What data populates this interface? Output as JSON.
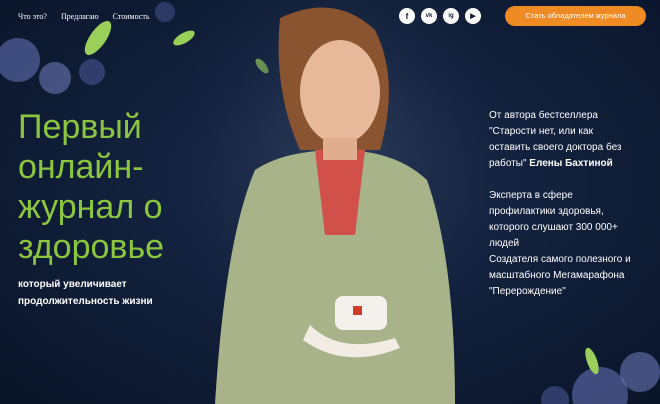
{
  "nav": {
    "items": [
      "Что это?",
      "Предлагаю",
      "Стоимость"
    ]
  },
  "social": {
    "items": [
      "f",
      "vk",
      "ig",
      "▶"
    ]
  },
  "cta": {
    "label": "Стать обладателем журнала"
  },
  "hero": {
    "headline": [
      "Первый",
      "онлайн-",
      "журнал о",
      "здоровье"
    ],
    "subheadline": [
      "который увеличивает",
      "продолжительность жизни"
    ],
    "author_lines": [
      "От автора бестселлера",
      "\"Старости нет, или как",
      "оставить своего доктора без",
      "работы\""
    ],
    "author_name": "Елены Бахтиной",
    "expert_lines": [
      "Эксперта в сфере",
      "профилактики здоровья,",
      "которого слушают 300 000+",
      "людей",
      "Создателя самого полезного и",
      "масштабного Мегамарафона",
      "\"Перерождение\""
    ]
  },
  "colors": {
    "accent_green": "#8cc63f",
    "cta_orange": "#f08a24",
    "background": "#0c1830"
  }
}
